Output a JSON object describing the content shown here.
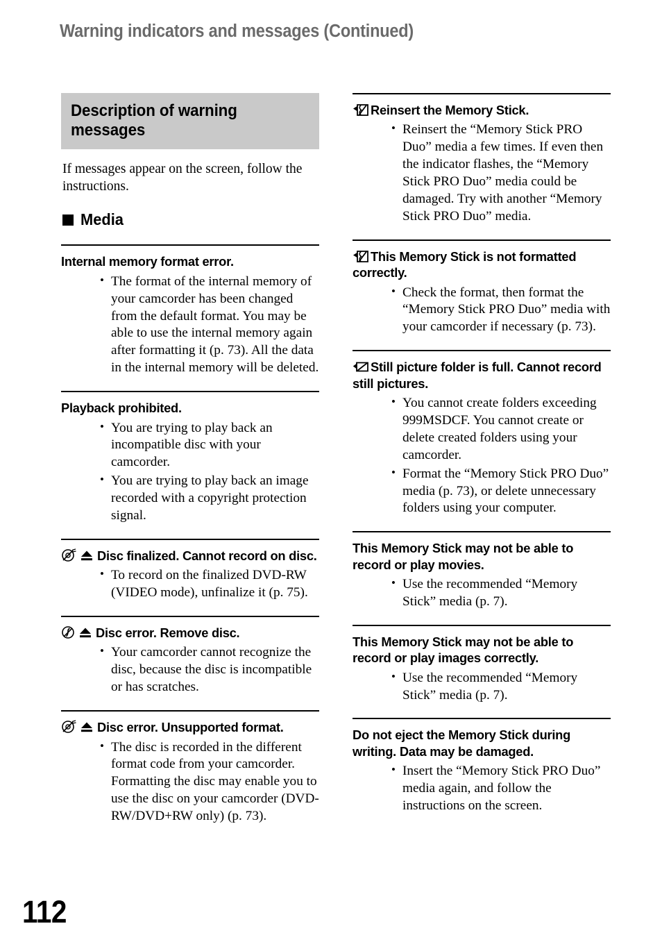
{
  "page": {
    "running_head": "Warning indicators and messages (Continued)",
    "folio": "112"
  },
  "section": {
    "title": "Description of warning messages",
    "intro": "If messages appear on the screen, follow the instructions.",
    "group_label": "Media",
    "group_bullet_icon": "filled-square-icon"
  },
  "left_column": {
    "entries": [
      {
        "icons": [],
        "title": "Internal memory format error.",
        "bullets": [
          "The format of the internal memory of your camcorder has been changed from the default format. You may be able to use the internal memory again after formatting it (p. 73). All the data in the internal memory will be deleted."
        ]
      },
      {
        "icons": [],
        "title": "Playback prohibited.",
        "bullets": [
          "You are trying to play back an incompatible disc with your camcorder.",
          "You are trying to play back an image recorded with a copyright protection signal."
        ]
      },
      {
        "icons": [
          "disc-prohibited-icon",
          "eject-icon"
        ],
        "title": "Disc finalized. Cannot record on disc.",
        "bullets": [
          "To record on the finalized DVD-RW (VIDEO mode), unfinalize it (p. 75)."
        ]
      },
      {
        "icons": [
          "disc-flashing-icon",
          "eject-icon"
        ],
        "title": "Disc error. Remove disc.",
        "bullets": [
          "Your camcorder cannot recognize the disc, because the disc is incompatible or has scratches."
        ]
      },
      {
        "icons": [
          "disc-prohibited-icon",
          "eject-icon"
        ],
        "title": "Disc error. Unsupported format.",
        "bullets": [
          "The disc is recorded in the different format code from your camcorder. Formatting the disc may enable you to use the disc on your camcorder (DVD-RW/DVD+RW only) (p. 73)."
        ]
      }
    ]
  },
  "right_column": {
    "entries": [
      {
        "icons": [
          "memory-stick-reinsert-icon"
        ],
        "title": "Reinsert the Memory Stick.",
        "bullets": [
          "Reinsert the “Memory Stick PRO Duo” media a few times. If even then the indicator flashes, the “Memory Stick PRO Duo” media could be damaged. Try with another “Memory Stick PRO Duo” media."
        ]
      },
      {
        "icons": [
          "memory-stick-reinsert-icon"
        ],
        "title": "This Memory Stick is not formatted correctly.",
        "bullets": [
          "Check the format, then format the “Memory Stick PRO Duo” media with your camcorder if necessary (p. 73)."
        ]
      },
      {
        "icons": [
          "still-picture-folder-full-icon"
        ],
        "title": "Still picture folder is full. Cannot record still pictures.",
        "bullets": [
          "You cannot create folders exceeding 999MSDCF. You cannot create or delete created folders using your camcorder.",
          "Format the “Memory Stick PRO Duo” media (p. 73), or delete unnecessary folders using your computer."
        ]
      },
      {
        "icons": [],
        "title": "This Memory Stick may not be able to record or play movies.",
        "bullets": [
          "Use the recommended “Memory Stick” media (p. 7)."
        ]
      },
      {
        "icons": [],
        "title": "This Memory Stick may not be able to record or play images correctly.",
        "bullets": [
          "Use the recommended “Memory Stick” media (p. 7)."
        ]
      },
      {
        "icons": [],
        "title": "Do not eject the Memory Stick during writing. Data may be damaged.",
        "bullets": [
          "Insert the “Memory Stick PRO Duo” media again, and follow the instructions on the screen."
        ]
      }
    ]
  },
  "colors": {
    "running_head": "#6a6a6a",
    "section_box_bg": "#c9c9c9",
    "text": "#000000",
    "page_bg": "#ffffff"
  }
}
